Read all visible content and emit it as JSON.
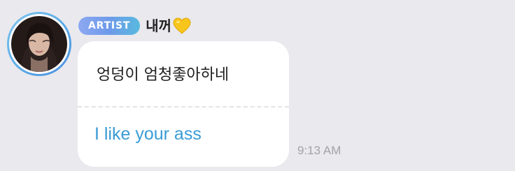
{
  "message": {
    "author": {
      "badge": "ARTIST",
      "name": "내꺼",
      "name_emoji": "yellow-heart-icon",
      "avatar": "artist-avatar-photo"
    },
    "original_text": "엉덩이 엄청좋아하네",
    "translated_text": "I like your ass",
    "timestamp": "9:13 AM"
  },
  "colors": {
    "background": "#e9e9ee",
    "bubble": "#ffffff",
    "translation_text": "#3a9bd6",
    "badge_gradient_start": "#8da8f2",
    "badge_gradient_end": "#58b9df",
    "avatar_ring": "#5aa9e6",
    "timestamp_text": "#a2a2a8"
  }
}
